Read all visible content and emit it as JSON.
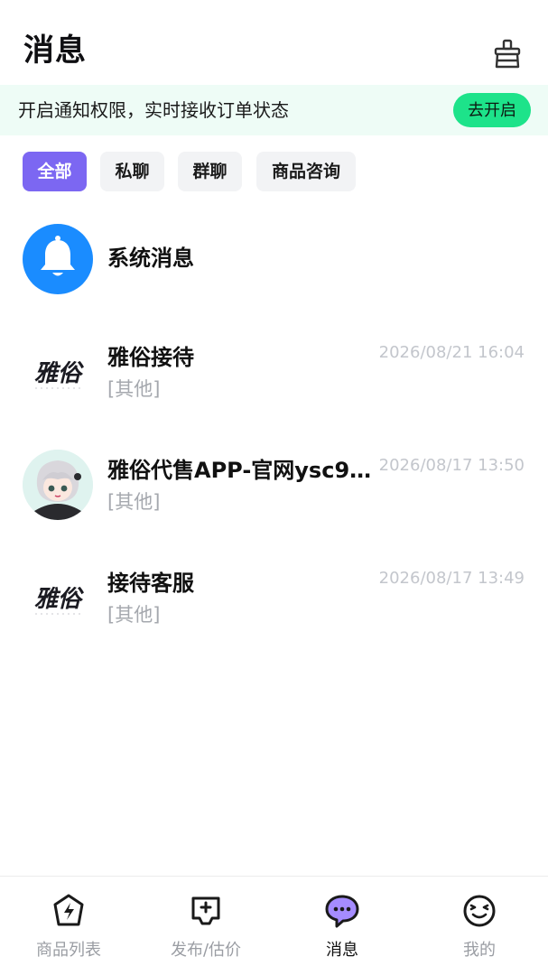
{
  "header": {
    "title": "消息"
  },
  "notice": {
    "text": "开启通知权限，实时接收订单状态",
    "button_label": "去开启"
  },
  "filters": [
    {
      "label": "全部",
      "active": true
    },
    {
      "label": "私聊",
      "active": false
    },
    {
      "label": "群聊",
      "active": false
    },
    {
      "label": "商品咨询",
      "active": false
    }
  ],
  "conversations": [
    {
      "name": "系统消息",
      "time": "",
      "preview": "",
      "avatar": "bell-icon"
    },
    {
      "name": "雅俗接待",
      "time": "2026/08/21 16:04",
      "preview": "[其他]",
      "avatar": "brand-logo",
      "logo_text": "雅俗"
    },
    {
      "name": "雅俗代售APP-官网ysc9…",
      "time": "2026/08/17 13:50",
      "preview": "[其他]",
      "avatar": "anime-avatar"
    },
    {
      "name": "接待客服",
      "time": "2026/08/17 13:49",
      "preview": "[其他]",
      "avatar": "brand-logo",
      "logo_text": "雅俗"
    }
  ],
  "tabbar": [
    {
      "label": "商品列表",
      "icon": "bolt-shield-icon",
      "active": false
    },
    {
      "label": "发布/估价",
      "icon": "gamepad-plus-icon",
      "active": false
    },
    {
      "label": "消息",
      "icon": "chat-bubble-icon",
      "active": true
    },
    {
      "label": "我的",
      "icon": "wink-face-icon",
      "active": false
    }
  ],
  "colors": {
    "accent": "#7c67f2",
    "notice_bg": "#eefcf6",
    "notice_button": "#1de38a",
    "bell_blue": "#1a8cff"
  }
}
